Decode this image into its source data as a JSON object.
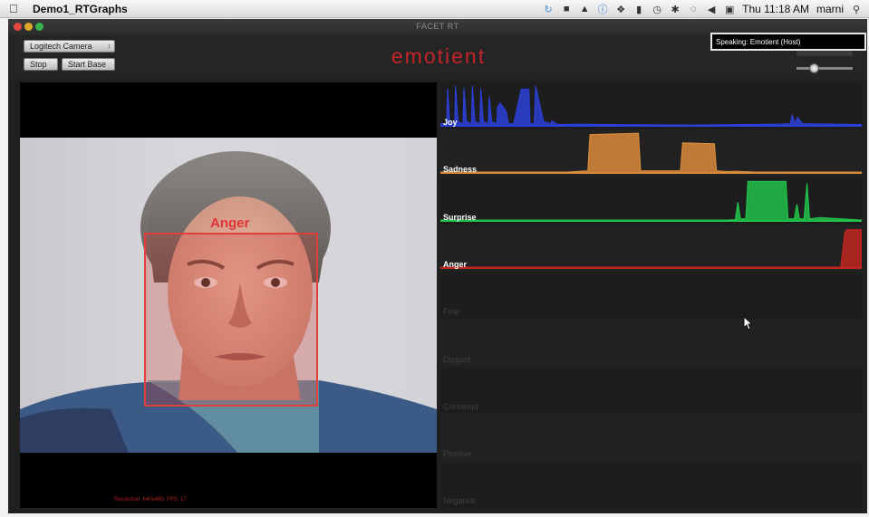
{
  "menubar": {
    "app_name": "Demo1_RTGraphs",
    "clock": "Thu 11:18 AM",
    "user": "marni"
  },
  "window": {
    "title": "FACET RT",
    "brand": "emotient"
  },
  "toolbar": {
    "camera_select": "Logitech Camera",
    "stop_label": "Stop",
    "start_base_label": "Start Base",
    "speaking": "Speaking: Emotient (Host)"
  },
  "video": {
    "face_label": "Anger",
    "resolution_text": "Resolution: 640x480, FPS: 17"
  },
  "colors": {
    "joy": "#2b3fd6",
    "sadness": "#d98a3a",
    "surprise": "#21c14a",
    "anger": "#c1261f",
    "accent": "#c4242a"
  },
  "chart_data": {
    "type": "area",
    "xlim": [
      0,
      100
    ],
    "ylim": [
      0,
      1
    ],
    "series": [
      {
        "name": "Joy",
        "color": "#2b3fd6",
        "x": [
          0,
          1.5,
          1.7,
          2.2,
          3.4,
          3.6,
          4.2,
          5.4,
          5.6,
          6.2,
          7.4,
          7.6,
          8.2,
          9.4,
          9.6,
          10.2,
          11.4,
          11.6,
          12.2,
          13.4,
          13.6,
          14.2,
          15.6,
          16.2,
          17.4,
          19.2,
          21,
          21.3,
          22.3,
          22.6,
          24.5,
          26.2,
          26.5,
          27.4,
          28,
          29,
          32,
          40,
          60,
          80,
          83,
          83.5,
          84.2,
          84.8,
          86,
          100
        ],
        "y": [
          0.05,
          0.05,
          0.9,
          0.1,
          0.05,
          0.95,
          0.1,
          0.05,
          0.9,
          0.1,
          0.05,
          0.95,
          0.1,
          0.05,
          0.9,
          0.1,
          0.05,
          0.7,
          0.1,
          0.05,
          0.45,
          0.55,
          0.35,
          0.05,
          0.05,
          0.88,
          0.88,
          0.05,
          0.05,
          0.95,
          0.1,
          0.05,
          0.12,
          0.05,
          0.03,
          0.03,
          0.04,
          0.03,
          0.02,
          0.04,
          0.05,
          0.25,
          0.05,
          0.2,
          0.05,
          0.03
        ]
      },
      {
        "name": "Sadness",
        "color": "#d98a3a",
        "x": [
          0,
          30,
          35,
          35.5,
          47,
          47.5,
          57,
          57.5,
          65,
          65.5,
          68,
          70,
          75,
          100
        ],
        "y": [
          0.02,
          0.02,
          0.05,
          0.92,
          0.95,
          0.05,
          0.05,
          0.72,
          0.7,
          0.05,
          0.03,
          0.04,
          0.02,
          0.02
        ]
      },
      {
        "name": "Surprise",
        "color": "#21c14a",
        "x": [
          0,
          68,
          70,
          70.6,
          71.2,
          72.5,
          73,
          82,
          82.5,
          84,
          84.6,
          85.2,
          86.3,
          87.0,
          87.6,
          90,
          100
        ],
        "y": [
          0.02,
          0.02,
          0.03,
          0.45,
          0.05,
          0.05,
          0.95,
          0.95,
          0.05,
          0.05,
          0.4,
          0.05,
          0.05,
          0.9,
          0.05,
          0.08,
          0.02
        ]
      },
      {
        "name": "Anger",
        "color": "#c1261f",
        "x": [
          0,
          95,
          96,
          96.5,
          100
        ],
        "y": [
          0.02,
          0.02,
          0.85,
          0.92,
          0.92
        ]
      }
    ],
    "empty_series": [
      "Fear",
      "Disgust",
      "Contempt",
      "Positive",
      "Negative"
    ]
  }
}
